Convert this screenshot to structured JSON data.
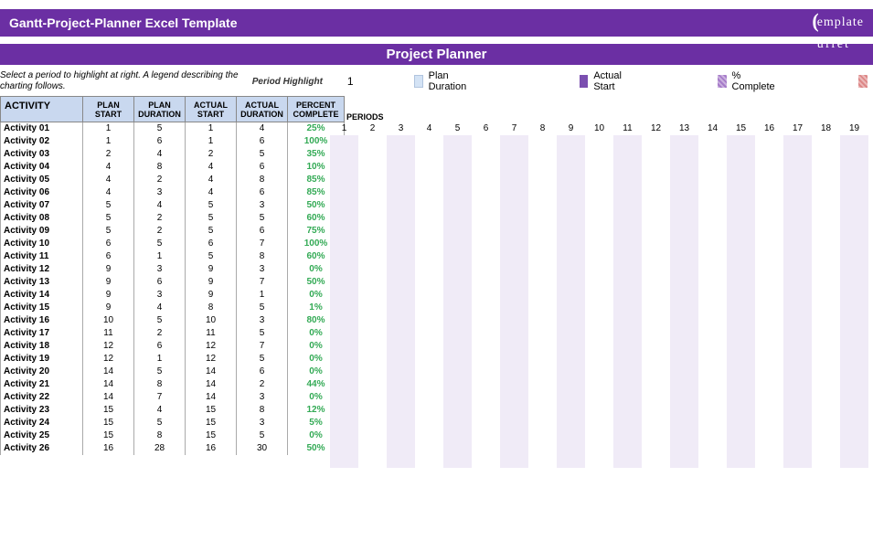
{
  "header": {
    "title": "Gantt-Project-Planner Excel Template",
    "logo_top": "emplate",
    "logo_bottom": "uffet"
  },
  "subheader": "Project Planner",
  "legend": {
    "desc": "Select a period to highlight at right.  A legend describing the charting follows.",
    "period_highlight_label": "Period Highlight",
    "period_highlight_value": "1",
    "items": {
      "plan": "Plan Duration",
      "actual": "Actual Start",
      "pct": "% Complete"
    }
  },
  "columns": {
    "activity": "ACTIVITY",
    "plan_start": "PLAN START",
    "plan_dur": "PLAN DURATION",
    "act_start": "ACTUAL START",
    "act_dur": "ACTUAL DURATION",
    "pct": "PERCENT COMPLETE",
    "periods": "PERIODS"
  },
  "period_numbers": [
    "1",
    "2",
    "3",
    "4",
    "5",
    "6",
    "7",
    "8",
    "9",
    "10",
    "11",
    "12",
    "13",
    "14",
    "15",
    "16",
    "17",
    "18",
    "19"
  ],
  "rows": [
    {
      "a": "Activity 01",
      "ps": "1",
      "pd": "5",
      "as": "1",
      "ad": "4",
      "pc": "25%"
    },
    {
      "a": "Activity 02",
      "ps": "1",
      "pd": "6",
      "as": "1",
      "ad": "6",
      "pc": "100%"
    },
    {
      "a": "Activity 03",
      "ps": "2",
      "pd": "4",
      "as": "2",
      "ad": "5",
      "pc": "35%"
    },
    {
      "a": "Activity 04",
      "ps": "4",
      "pd": "8",
      "as": "4",
      "ad": "6",
      "pc": "10%"
    },
    {
      "a": "Activity 05",
      "ps": "4",
      "pd": "2",
      "as": "4",
      "ad": "8",
      "pc": "85%"
    },
    {
      "a": "Activity 06",
      "ps": "4",
      "pd": "3",
      "as": "4",
      "ad": "6",
      "pc": "85%"
    },
    {
      "a": "Activity 07",
      "ps": "5",
      "pd": "4",
      "as": "5",
      "ad": "3",
      "pc": "50%"
    },
    {
      "a": "Activity 08",
      "ps": "5",
      "pd": "2",
      "as": "5",
      "ad": "5",
      "pc": "60%"
    },
    {
      "a": "Activity 09",
      "ps": "5",
      "pd": "2",
      "as": "5",
      "ad": "6",
      "pc": "75%"
    },
    {
      "a": "Activity 10",
      "ps": "6",
      "pd": "5",
      "as": "6",
      "ad": "7",
      "pc": "100%"
    },
    {
      "a": "Activity 11",
      "ps": "6",
      "pd": "1",
      "as": "5",
      "ad": "8",
      "pc": "60%"
    },
    {
      "a": "Activity 12",
      "ps": "9",
      "pd": "3",
      "as": "9",
      "ad": "3",
      "pc": "0%"
    },
    {
      "a": "Activity 13",
      "ps": "9",
      "pd": "6",
      "as": "9",
      "ad": "7",
      "pc": "50%"
    },
    {
      "a": "Activity 14",
      "ps": "9",
      "pd": "3",
      "as": "9",
      "ad": "1",
      "pc": "0%"
    },
    {
      "a": "Activity 15",
      "ps": "9",
      "pd": "4",
      "as": "8",
      "ad": "5",
      "pc": "1%"
    },
    {
      "a": "Activity 16",
      "ps": "10",
      "pd": "5",
      "as": "10",
      "ad": "3",
      "pc": "80%"
    },
    {
      "a": "Activity 17",
      "ps": "11",
      "pd": "2",
      "as": "11",
      "ad": "5",
      "pc": "0%"
    },
    {
      "a": "Activity 18",
      "ps": "12",
      "pd": "6",
      "as": "12",
      "ad": "7",
      "pc": "0%"
    },
    {
      "a": "Activity 19",
      "ps": "12",
      "pd": "1",
      "as": "12",
      "ad": "5",
      "pc": "0%"
    },
    {
      "a": "Activity 20",
      "ps": "14",
      "pd": "5",
      "as": "14",
      "ad": "6",
      "pc": "0%"
    },
    {
      "a": "Activity 21",
      "ps": "14",
      "pd": "8",
      "as": "14",
      "ad": "2",
      "pc": "44%"
    },
    {
      "a": "Activity 22",
      "ps": "14",
      "pd": "7",
      "as": "14",
      "ad": "3",
      "pc": "0%"
    },
    {
      "a": "Activity 23",
      "ps": "15",
      "pd": "4",
      "as": "15",
      "ad": "8",
      "pc": "12%"
    },
    {
      "a": "Activity 24",
      "ps": "15",
      "pd": "5",
      "as": "15",
      "ad": "3",
      "pc": "5%"
    },
    {
      "a": "Activity 25",
      "ps": "15",
      "pd": "8",
      "as": "15",
      "ad": "5",
      "pc": "0%"
    },
    {
      "a": "Activity 26",
      "ps": "16",
      "pd": "28",
      "as": "16",
      "ad": "30",
      "pc": "50%"
    }
  ]
}
